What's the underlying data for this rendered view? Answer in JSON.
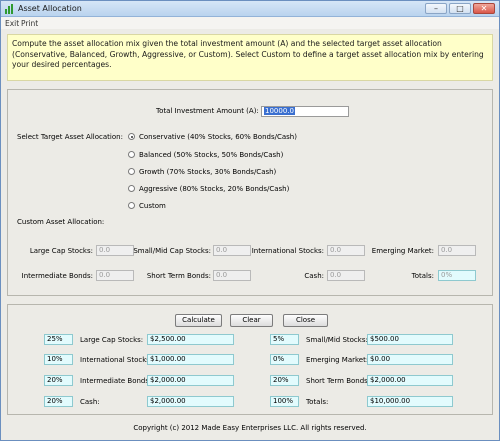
{
  "window": {
    "title": "Asset Allocation",
    "icon": "bar-chart-icon",
    "controls": [
      "minimize-icon",
      "maximize-icon",
      "close-icon"
    ]
  },
  "menu": [
    "Exit",
    "Print"
  ],
  "info": "Compute the asset allocation mix given the total investment amount (A) and the selected target asset allocation (Conservative, Balanced, Growth, Aggressive, or Custom). Select Custom to define a target asset allocation mix by entering your desired percentages.",
  "total_investment": {
    "label": "Total Investment Amount (A):",
    "value": "10000.0"
  },
  "target": {
    "label": "Select Target Asset Allocation:",
    "options": [
      {
        "label": "Conservative (40% Stocks, 60% Bonds/Cash)",
        "selected": true
      },
      {
        "label": "Balanced (50% Stocks, 50% Bonds/Cash)",
        "selected": false
      },
      {
        "label": "Growth (70% Stocks, 30% Bonds/Cash)",
        "selected": false
      },
      {
        "label": "Aggressive (80% Stocks, 20% Bonds/Cash)",
        "selected": false
      },
      {
        "label": "Custom",
        "selected": false
      }
    ]
  },
  "custom": {
    "label": "Custom Asset Allocation:",
    "large_cap": {
      "label": "Large Cap Stocks:",
      "value": "0.0"
    },
    "small_mid": {
      "label": "Small/Mid Cap Stocks:",
      "value": "0.0"
    },
    "international": {
      "label": "International Stocks:",
      "value": "0.0"
    },
    "emerging": {
      "label": "Emerging Market:",
      "value": "0.0"
    },
    "intermediate": {
      "label": "Intermediate Bonds:",
      "value": "0.0"
    },
    "short_term": {
      "label": "Short Term Bonds:",
      "value": "0.0"
    },
    "cash": {
      "label": "Cash:",
      "value": "0.0"
    },
    "totals": {
      "label": "Totals:",
      "value": "0%"
    }
  },
  "buttons": {
    "calculate": "Calculate",
    "clear": "Clear",
    "close": "Close"
  },
  "results": {
    "left": [
      {
        "pct": "25%",
        "label": "Large Cap Stocks:",
        "value": "$2,500.00"
      },
      {
        "pct": "10%",
        "label": "International Stocks:",
        "value": "$1,000.00"
      },
      {
        "pct": "20%",
        "label": "Intermediate Bonds:",
        "value": "$2,000.00"
      },
      {
        "pct": "20%",
        "label": "Cash:",
        "value": "$2,000.00"
      }
    ],
    "right": [
      {
        "pct": "5%",
        "label": "Small/Mid Stocks:",
        "value": "$500.00"
      },
      {
        "pct": "0%",
        "label": "Emerging Market:",
        "value": "$0.00"
      },
      {
        "pct": "20%",
        "label": "Short Term Bonds:",
        "value": "$2,000.00"
      },
      {
        "pct": "100%",
        "label": "Totals:",
        "value": "$10,000.00"
      }
    ]
  },
  "copyright": "Copyright (c) 2012 Made Easy Enterprises LLC. All rights reserved."
}
